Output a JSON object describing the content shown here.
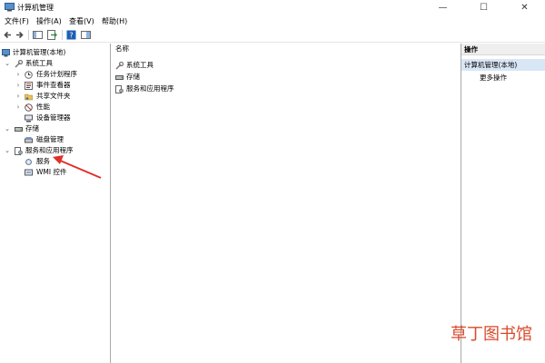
{
  "window": {
    "title": "计算机管理",
    "minimize": "—",
    "maximize": "☐",
    "close": "✕"
  },
  "menu": {
    "file": "文件(F)",
    "action": "操作(A)",
    "view": "查看(V)",
    "help": "帮助(H)"
  },
  "tree": {
    "root": "计算机管理(本地)",
    "system_tools": "系统工具",
    "task_scheduler": "任务计划程序",
    "event_viewer": "事件查看器",
    "shared_folders": "共享文件夹",
    "performance": "性能",
    "device_manager": "设备管理器",
    "storage": "存储",
    "disk_management": "磁盘管理",
    "services_apps": "服务和应用程序",
    "services": "服务",
    "wmi": "WMI 控件"
  },
  "list": {
    "column_name": "名称",
    "items": [
      "系统工具",
      "存储",
      "服务和应用程序"
    ]
  },
  "actions": {
    "header": "操作",
    "section": "计算机管理(本地)",
    "more": "更多操作"
  },
  "watermark": "草丁图书馆",
  "colors": {
    "selection": "#d8e6f5",
    "arrow": "#e0302a",
    "watermark": "#d94a2b"
  }
}
